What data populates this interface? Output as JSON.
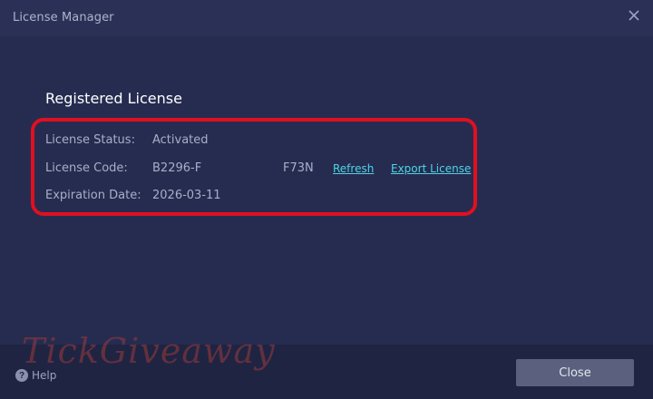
{
  "window": {
    "title": "License Manager"
  },
  "license": {
    "section_title": "Registered License",
    "status": {
      "label": "License Status:",
      "value": "Activated"
    },
    "code": {
      "label": "License Code:",
      "value": "B2296-F",
      "suffix": "F73N"
    },
    "expiration": {
      "label": "Expiration Date:",
      "value": "2026-03-11"
    },
    "actions": {
      "refresh": "Refresh",
      "export": "Export License"
    }
  },
  "footer": {
    "help_label": "Help",
    "close_label": "Close"
  },
  "watermark": "TickGiveaway",
  "colors": {
    "background": "#262c50",
    "titlebar": "#2b3156",
    "footer": "#1f2443",
    "link": "#4fd3e3",
    "highlight": "#e01020",
    "button": "#5a607e"
  },
  "icons": {
    "close": "close-icon",
    "help": "help-icon"
  }
}
